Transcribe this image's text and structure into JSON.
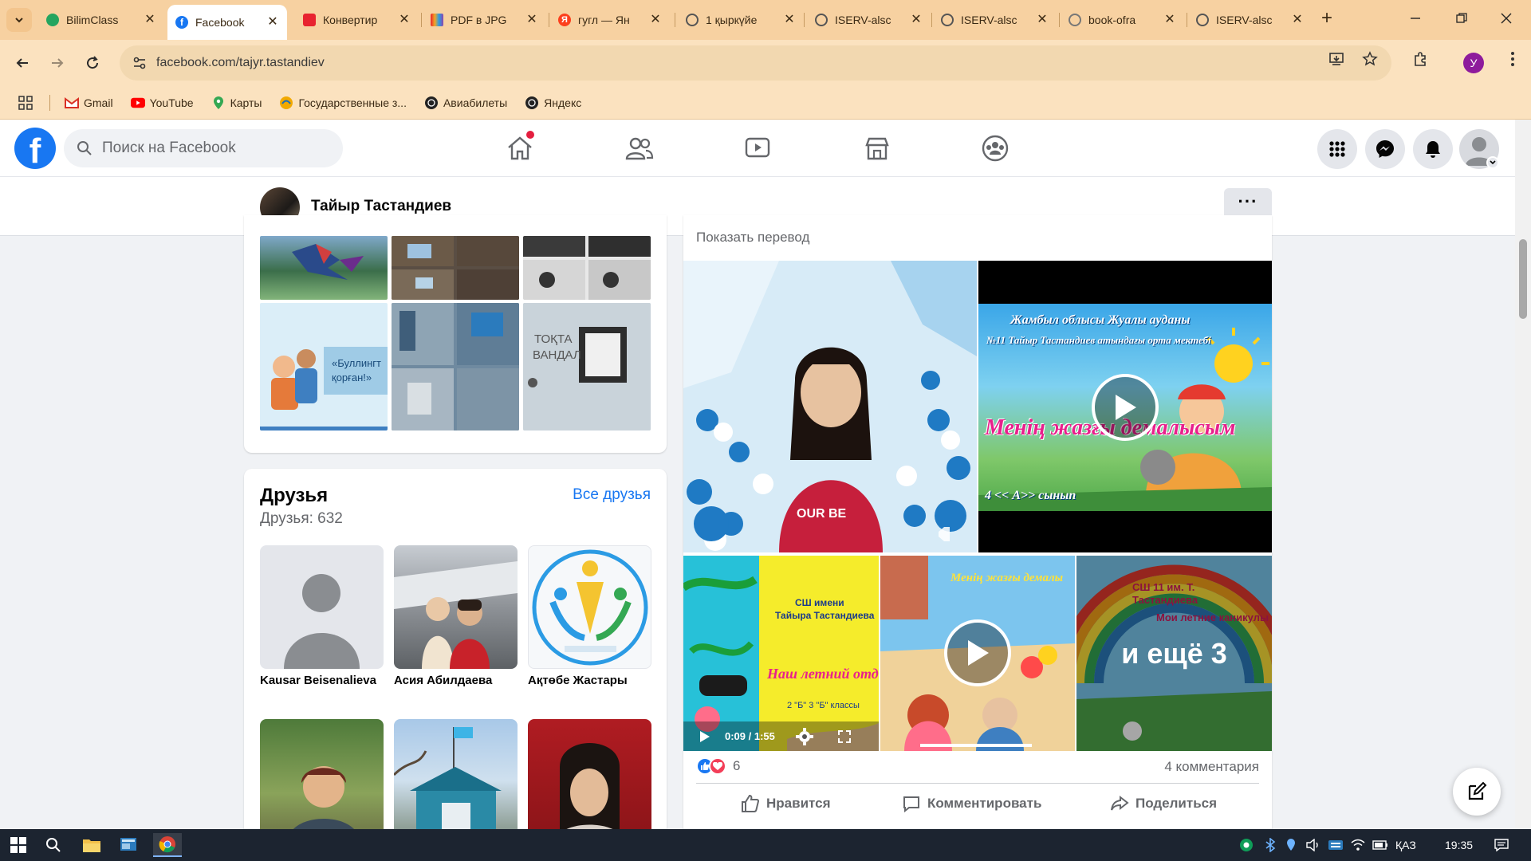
{
  "browser": {
    "tabs": [
      {
        "label": "BilimClass",
        "color": "#25a55f"
      },
      {
        "label": "Facebook",
        "color": "#1877f2",
        "active": true
      },
      {
        "label": "Конвертир",
        "color": "#e8232f"
      },
      {
        "label": "PDF в JPG",
        "color": "#f4a623"
      },
      {
        "label": "гугл — Ян",
        "color": "#fc3f1d"
      },
      {
        "label": "1 қыркүйе",
        "color": "#555555"
      },
      {
        "label": "ISERV-alsc",
        "color": "#555555"
      },
      {
        "label": "ISERV-alsc",
        "color": "#555555"
      },
      {
        "label": "book-ofra",
        "color": "#777777"
      },
      {
        "label": "ISERV-alsc",
        "color": "#555555"
      }
    ],
    "url": "facebook.com/tajyr.tastandiev",
    "profile_initial": "У",
    "bookmarks": [
      {
        "label": "Gmail",
        "icon": "gmail-icon"
      },
      {
        "label": "YouTube",
        "icon": "youtube-icon"
      },
      {
        "label": "Карты",
        "icon": "maps-icon"
      },
      {
        "label": "Государственные з...",
        "icon": "gov-icon"
      },
      {
        "label": "Авиабилеты",
        "icon": "globe-icon"
      },
      {
        "label": "Яндекс",
        "icon": "globe-icon"
      }
    ]
  },
  "facebook": {
    "search_placeholder": "Поиск на Facebook",
    "profile_name": "Тайыр Тастандиев",
    "more_label": "···",
    "friends": {
      "title": "Друзья",
      "count_text": "Друзья: 632",
      "all_link": "Все друзья",
      "items": [
        {
          "name": "Kausar Beisenalieva"
        },
        {
          "name": "Асия Абилдаева"
        },
        {
          "name": "Ақтөбе Жастары"
        },
        {
          "name": ""
        },
        {
          "name": ""
        },
        {
          "name": ""
        }
      ]
    },
    "post": {
      "translate_link": "Показать перевод",
      "video_title_line1": "Жамбыл облысы Жуалы ауданы",
      "video_title_line2": "№11 Тайыр Тастандиев атындағы орта мектебі",
      "video_title_big": "Менің жазғы демалысым",
      "video_caption": "4 << А>> сынып",
      "thumb1_line1": "СШ имени",
      "thumb1_line2": "Тайыра Тастандиева",
      "thumb1_big": "Наш летний отдых",
      "thumb1_classes": "2 \"Б\" 3 \"Б\" классы",
      "thumb1_time": "0:09 / 1:55",
      "thumb2_title": "Менің жазғы демалы",
      "thumb3_line1": "СШ 11 им. Т.",
      "thumb3_line2": "Тастандиева",
      "thumb3_line3": "Мои летние каникулы",
      "more_count": "и ещё 3",
      "reaction_count": "6",
      "comments": "4 комментария",
      "actions": {
        "like": "Нравится",
        "comment": "Комментировать",
        "share": "Поделиться"
      }
    }
  },
  "taskbar": {
    "lang": "ҚАЗ",
    "time": "19:35"
  }
}
